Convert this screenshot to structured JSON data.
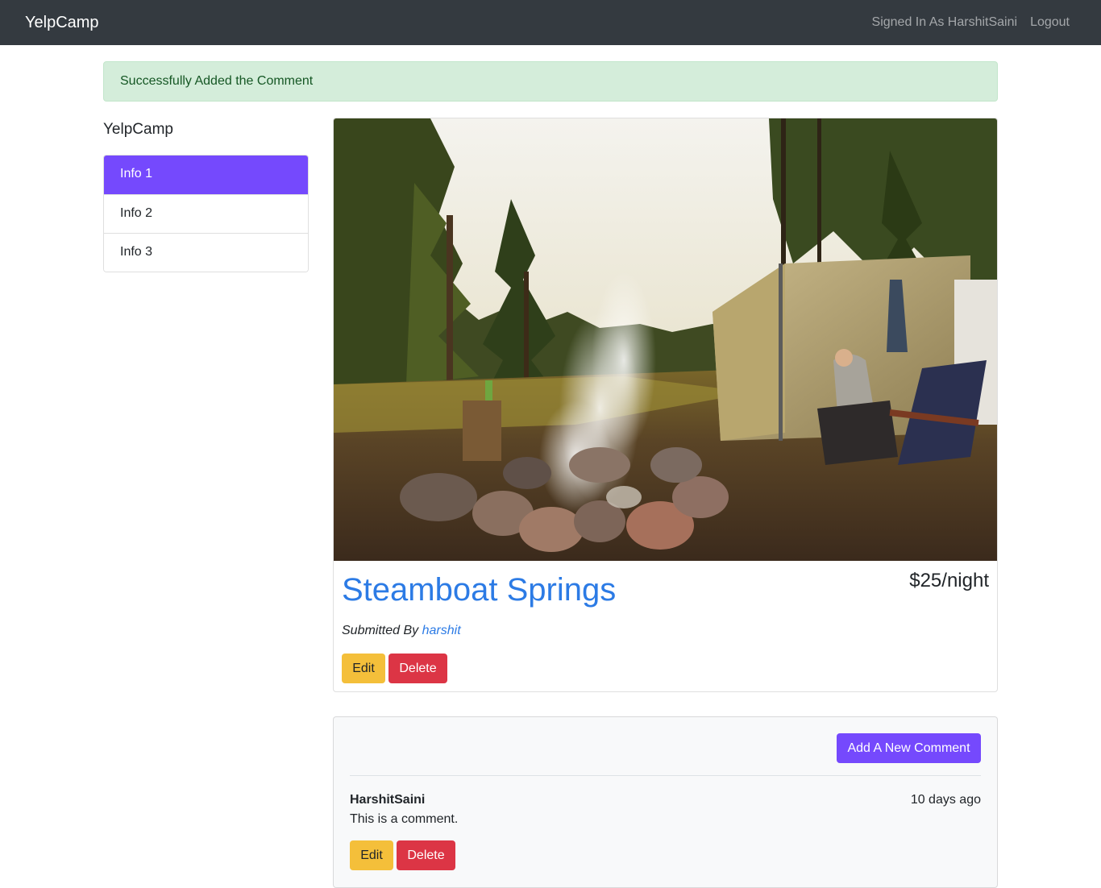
{
  "navbar": {
    "brand": "YelpCamp",
    "signed_in": "Signed In As HarshitSaini",
    "logout": "Logout"
  },
  "alert": {
    "message": "Successfully Added the Comment"
  },
  "sidebar": {
    "title": "YelpCamp",
    "items": [
      {
        "label": "Info 1",
        "active": true
      },
      {
        "label": "Info 2",
        "active": false
      },
      {
        "label": "Info 3",
        "active": false
      }
    ]
  },
  "campground": {
    "name": "Steamboat Springs",
    "price": "$25/night",
    "submitted_prefix": "Submitted By",
    "author": "harshit",
    "edit_label": "Edit",
    "delete_label": "Delete"
  },
  "comments": {
    "add_label": "Add A New Comment",
    "items": [
      {
        "author": "HarshitSaini",
        "time": "10 days ago",
        "text": "This is a comment.",
        "edit_label": "Edit",
        "delete_label": "Delete"
      }
    ]
  },
  "colors": {
    "navbar": "#343a40",
    "accent": "#7549fd",
    "warning": "#f4bf3a",
    "danger": "#dc3545",
    "link": "#2c7be5",
    "alert_bg": "#d4edda"
  }
}
